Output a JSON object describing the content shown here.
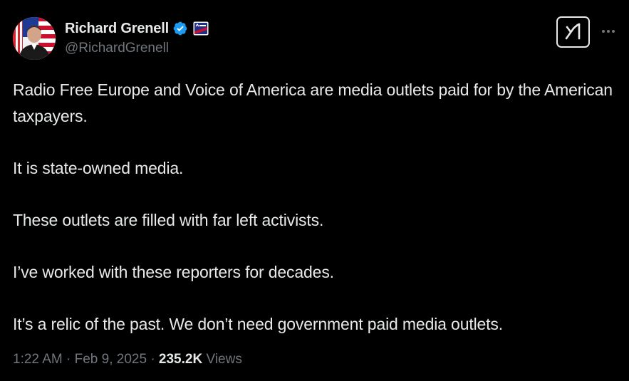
{
  "author": {
    "display_name": "Richard Grenell",
    "handle": "@RichardGrenell",
    "verified": true,
    "avatar_icon": "profile-photo-with-flag",
    "affiliate_badge_icon": "cpac-badge-icon"
  },
  "actions": {
    "grok_icon": "grok-icon",
    "more_icon": "more-options-icon"
  },
  "tweet": {
    "paragraphs": [
      "Radio Free Europe and Voice of America are media outlets paid for by the American taxpayers.",
      "It is state-owned media.",
      "These outlets are filled with far left activists.",
      "I’ve worked with these reporters for decades.",
      "It’s a relic of the past. We don’t need government paid media outlets."
    ]
  },
  "meta": {
    "time": "1:22 AM",
    "separator": "·",
    "date": "Feb 9, 2025",
    "views_count": "235.2K",
    "views_label": "Views"
  },
  "colors": {
    "background": "#000000",
    "text_primary": "#e7e9ea",
    "text_secondary": "#71767b",
    "verified_blue": "#1d9bf0"
  }
}
